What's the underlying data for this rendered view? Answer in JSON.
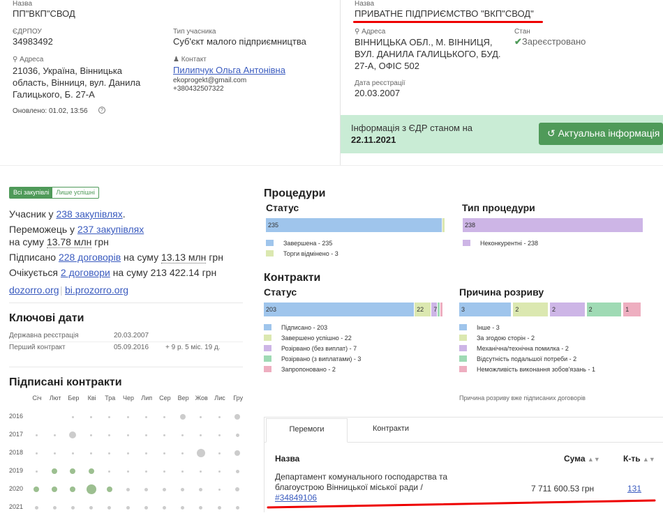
{
  "left_header": {
    "name_label": "Назва",
    "name": "ПП\"ВКП\"СВОД",
    "edrpou_label": "ЄДРПОУ",
    "edrpou": "34983492",
    "type_label": "Тип учасника",
    "type": "Суб'єкт малого підприємництва",
    "address_label": "Адреса",
    "address": "21036, Україна, Вінницька область, Вінниця, вул. Данила Галицького, Б. 27-А",
    "contact_label": "Контакт",
    "contact_name": "Пилипчук Ольга Антонівна",
    "contact_email": "ekoprogekt@gmail.com",
    "contact_phone": "+380432507322",
    "updated": "Оновлено: 01.02, 13:56",
    "help": "?"
  },
  "right_header": {
    "name_label": "Назва",
    "name": "ПРИВАТНЕ ПІДПРИЄМСТВО \"ВКП\"СВОД\"",
    "address_label": "Адреса",
    "address": "ВІННИЦЬКА ОБЛ., М. ВІННИЦЯ, ВУЛ. ДАНИЛА ГАЛИЦЬКОГО, БУД. 27-А, ОФІС 502",
    "state_label": "Стан",
    "state": "Зареєстровано",
    "reg_label": "Дата реєстрації",
    "reg_date": "20.03.2007",
    "banner_text": "Інформація з ЄДР станом на",
    "banner_date": "22.11.2021",
    "refresh_button": "Актуальна інформація"
  },
  "filters": {
    "all": "Всі закупівлі",
    "success": "Лише успішні"
  },
  "stats": {
    "participant_pre": "Учасник у",
    "participant_link": "238 закупівлях",
    "winner_pre": "Переможець у",
    "winner_link": "237 закупівлях",
    "winner_sum_pre": "на суму",
    "winner_sum": "13.78 млн",
    "winner_sum_unit": "грн",
    "signed_pre": "Підписано",
    "signed_link": "228 договорів",
    "signed_mid": "на суму",
    "signed_sum": "13.13 млн",
    "signed_unit": "грн",
    "expected_pre": "Очікується",
    "expected_link": "2 договори",
    "expected_rest": "на суму 213 422.14 грн",
    "link1": "dozorro.org",
    "link2": "bi.prozorro.org"
  },
  "key_dates": {
    "title": "Ключові дати",
    "reg_label": "Державна реєстрація",
    "reg_val": "20.03.2007",
    "first_label": "Перший контракт",
    "first_val": "05.09.2016",
    "first_ago": "+ 9 р. 5 міс. 19 д."
  },
  "signed": {
    "title": "Підписані контракти",
    "months": [
      "Січ",
      "Лют",
      "Бер",
      "Кві",
      "Тра",
      "Чер",
      "Лип",
      "Сер",
      "Вер",
      "Жов",
      "Лис",
      "Гру"
    ],
    "years": [
      "2016",
      "2017",
      "2018",
      "2019",
      "2020",
      "2021"
    ]
  },
  "procedures": {
    "title": "Процедури",
    "status_title": "Статус",
    "type_title": "Тип процедури",
    "status_legend": [
      "Завершена - 235",
      "Торги відмінено - 3"
    ],
    "status_bar_label": "235",
    "type_bar_label": "238",
    "type_legend": [
      "Неконкурентні - 238"
    ]
  },
  "contracts": {
    "title": "Контракти",
    "status_title": "Статус",
    "reason_title": "Причина розриву",
    "status_bar_labels": [
      "203",
      "22",
      "7"
    ],
    "status_legend": [
      "Підписано - 203",
      "Завершено успішно - 22",
      "Розірвано (без виплат) - 7",
      "Розірвано (з виплатами) - 3",
      "Запропоновано - 2"
    ],
    "reason_bar_labels": [
      "3",
      "2",
      "2",
      "2",
      "1"
    ],
    "reason_legend": [
      "Інше - 3",
      "За згодою сторін - 2",
      "Механічна/технічна помилка - 2",
      "Відсутність подальшої потреби - 2",
      "Неможливість виконання зобов'язань - 1"
    ],
    "reason_note": "Причина розриву вже підписаних договорів"
  },
  "chart_data": [
    {
      "type": "bar",
      "title": "Статус",
      "series": [
        {
          "name": "Завершена",
          "values": [
            235
          ]
        },
        {
          "name": "Торги відмінено",
          "values": [
            3
          ]
        }
      ],
      "categories": [
        "Процедури"
      ]
    },
    {
      "type": "bar",
      "title": "Тип процедури",
      "series": [
        {
          "name": "Неконкурентні",
          "values": [
            238
          ]
        }
      ],
      "categories": [
        "Процедури"
      ]
    },
    {
      "type": "bar",
      "title": "Статус",
      "series": [
        {
          "name": "Підписано",
          "values": [
            203
          ]
        },
        {
          "name": "Завершено успішно",
          "values": [
            22
          ]
        },
        {
          "name": "Розірвано (без виплат)",
          "values": [
            7
          ]
        },
        {
          "name": "Розірвано (з виплатами)",
          "values": [
            3
          ]
        },
        {
          "name": "Запропоновано",
          "values": [
            2
          ]
        }
      ],
      "categories": [
        "Контракти"
      ]
    },
    {
      "type": "bar",
      "title": "Причина розриву",
      "series": [
        {
          "name": "Інше",
          "values": [
            3
          ]
        },
        {
          "name": "За згодою сторін",
          "values": [
            2
          ]
        },
        {
          "name": "Механічна/технічна помилка",
          "values": [
            2
          ]
        },
        {
          "name": "Відсутність подальшої потреби",
          "values": [
            2
          ]
        },
        {
          "name": "Неможливість виконання зобов'язань",
          "values": [
            1
          ]
        }
      ],
      "categories": [
        "Контракти"
      ]
    }
  ],
  "colors": {
    "blue": "#9fc5ec",
    "lime": "#dbe8b0",
    "purple": "#cdb5e6",
    "green": "#9fdab4",
    "pink": "#eeaec0",
    "accent": "#4f9a59"
  },
  "tabs": {
    "wins": "Перемоги",
    "contracts": "Контракти"
  },
  "table": {
    "col_name": "Назва",
    "col_sum": "Сума",
    "col_count": "К-ть",
    "row_name": "Департамент комунального господарства та благоустрою Вінницької міської ради /",
    "row_id": "#34849106",
    "row_sum": "7 711 600.53 грн",
    "row_count": "131"
  }
}
